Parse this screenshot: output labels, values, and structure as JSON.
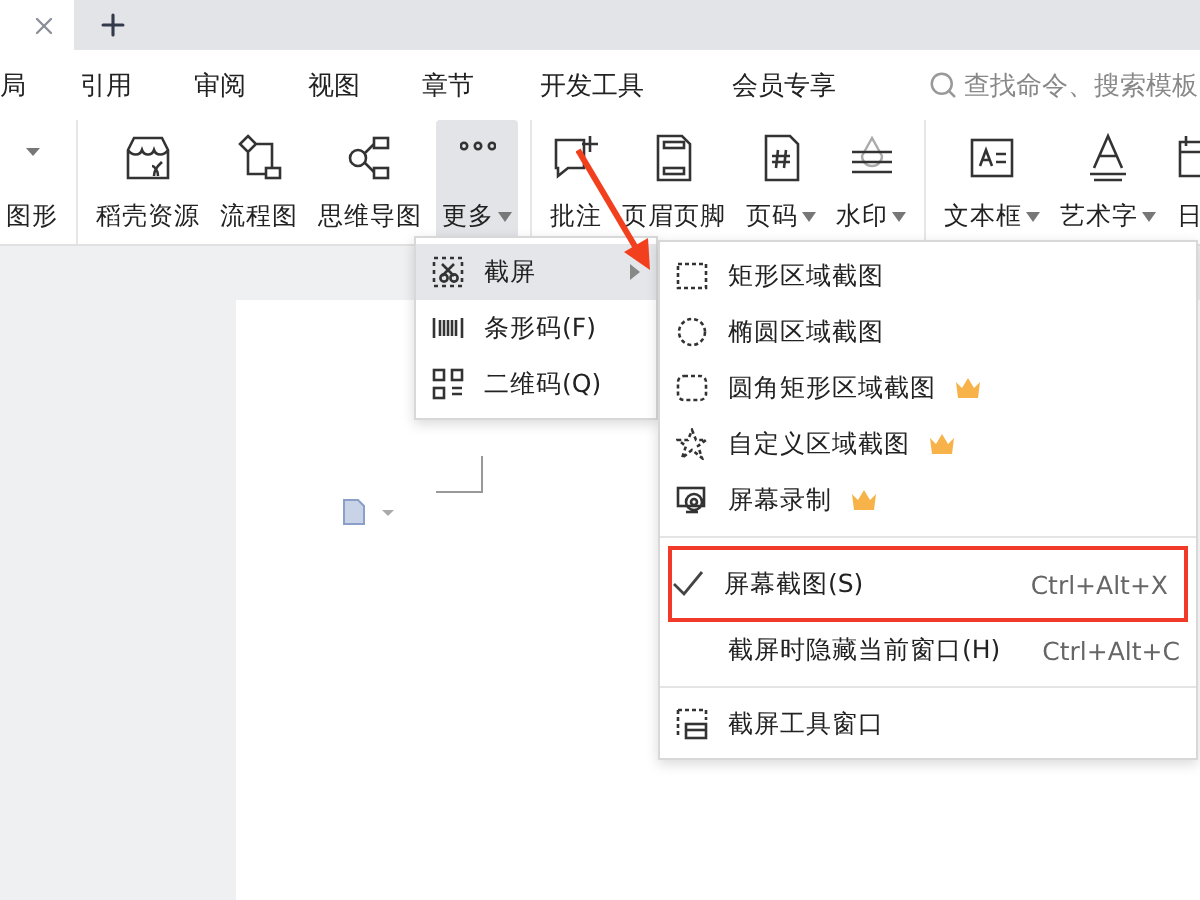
{
  "menu_bar": [
    {
      "label": "局",
      "selected": false
    },
    {
      "label": "引用",
      "selected": false
    },
    {
      "label": "审阅",
      "selected": false
    },
    {
      "label": "视图",
      "selected": false
    },
    {
      "label": "章节",
      "selected": false
    },
    {
      "label": "开发工具",
      "selected": false
    },
    {
      "label": "会员专享",
      "selected": false
    }
  ],
  "search": {
    "placeholder": "查找命令、搜索模板"
  },
  "ribbon": [
    [
      {
        "label": "图形",
        "dropdown": false,
        "selected": false
      }
    ],
    [
      {
        "label": "稻壳资源",
        "dropdown": false,
        "selected": false
      },
      {
        "label": "流程图",
        "dropdown": false,
        "selected": false
      },
      {
        "label": "思维导图",
        "dropdown": false,
        "selected": false
      },
      {
        "label": "更多",
        "dropdown": true,
        "selected": true
      }
    ],
    [
      {
        "label": "批注",
        "dropdown": false,
        "selected": false
      },
      {
        "label": "页眉页脚",
        "dropdown": false,
        "selected": false
      },
      {
        "label": "页码",
        "dropdown": true,
        "selected": false
      },
      {
        "label": "水印",
        "dropdown": true,
        "selected": false
      }
    ],
    [
      {
        "label": "文本框",
        "dropdown": true,
        "selected": false
      },
      {
        "label": "艺术字",
        "dropdown": true,
        "selected": false
      },
      {
        "label": "日",
        "dropdown": false,
        "selected": false
      }
    ]
  ],
  "more_menu": [
    {
      "label": "截屏",
      "highlighted": true,
      "submenu": true
    },
    {
      "label": "条形码(F)",
      "highlighted": false,
      "submenu": false
    },
    {
      "label": "二维码(Q)",
      "highlighted": false,
      "submenu": false
    }
  ],
  "screenshot_menu": [
    {
      "kind": "item",
      "label": "矩形区域截图",
      "premium": false,
      "checked": false,
      "marked": false
    },
    {
      "kind": "item",
      "label": "椭圆区域截图",
      "premium": false,
      "checked": false,
      "marked": false
    },
    {
      "kind": "item",
      "label": "圆角矩形区域截图",
      "premium": true,
      "checked": false,
      "marked": false
    },
    {
      "kind": "item",
      "label": "自定义区域截图",
      "premium": true,
      "checked": false,
      "marked": false
    },
    {
      "kind": "item",
      "label": "屏幕录制",
      "premium": true,
      "checked": false,
      "marked": false
    },
    {
      "kind": "divider"
    },
    {
      "kind": "item",
      "label": "屏幕截图(S)",
      "premium": false,
      "checked": true,
      "marked": true,
      "shortcut": "Ctrl+Alt+X"
    },
    {
      "kind": "item",
      "label": "截屏时隐藏当前窗口(H)",
      "premium": false,
      "checked": false,
      "marked": false,
      "shortcut": "Ctrl+Alt+C"
    },
    {
      "kind": "divider"
    },
    {
      "kind": "item",
      "label": "截屏工具窗口",
      "premium": false,
      "checked": false,
      "marked": false
    }
  ]
}
